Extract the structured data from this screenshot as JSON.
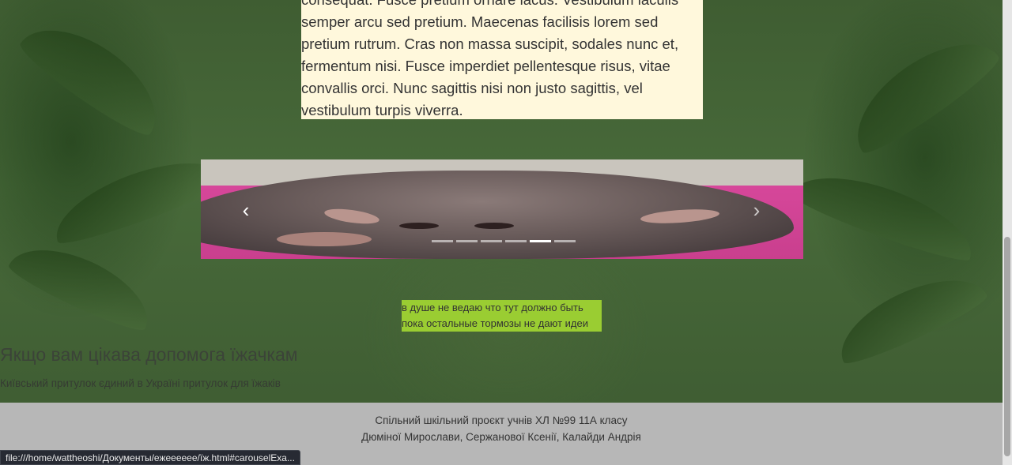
{
  "article": {
    "lines": [
      "consequat. Fusce pretium ornare lacus. Vestibulum iaculis",
      "semper arcu sed pretium. Maecenas facilisis lorem sed",
      "pretium rutrum. Cras non massa suscipit, sodales nunc et,",
      "fermentum nisi. Fusce imperdiet pellentesque risus, vitae",
      "convallis orci. Nunc sagittis nisi non justo sagittis, vel",
      "vestibulum turpis viverra."
    ]
  },
  "carousel": {
    "prev_icon": "chevron-left",
    "next_icon": "chevron-right",
    "prev_glyph": "‹",
    "next_glyph": "›",
    "slide_count": 6,
    "active_index": 4
  },
  "note": {
    "line1": "в душе не ведаю что тут должно быть",
    "line2": "пока остальные тормозы не дают идеи"
  },
  "help": {
    "title": "Якщо вам цікава допомога їжачкам",
    "subtitle": "Київський притулок єдиний в Україні притулок для їжаків"
  },
  "footer": {
    "line1": "Спільний шкільний проєкт учнів ХЛ №99 11А класу",
    "line2": "Дюміної Мирослави, Сержанової Ксенії, Калайди Андрія"
  },
  "status_bar": {
    "url": "file:///home/wattheoshi/Документы/ежееееее/їж.html#carouselExa..."
  },
  "colors": {
    "article_bg": "#fff8dc",
    "note_bg": "#9acd32",
    "footer_bg": "#b7b7b7"
  }
}
